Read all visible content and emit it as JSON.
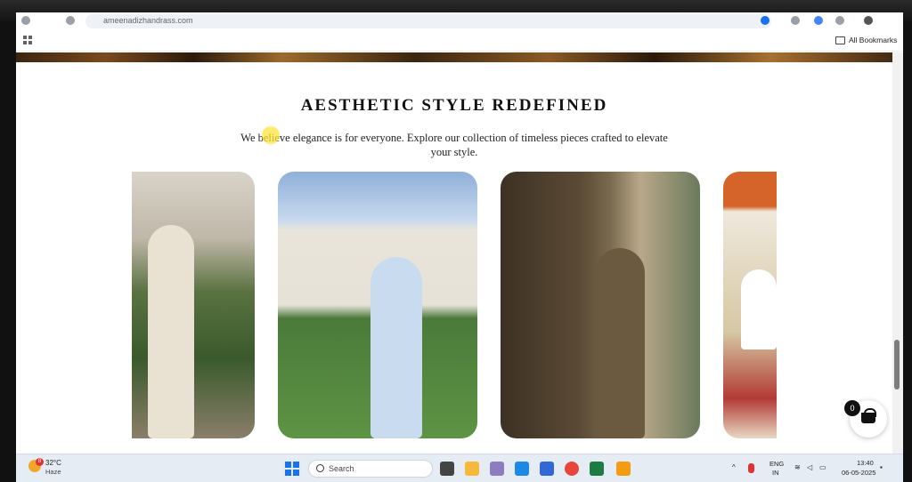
{
  "browser": {
    "url": "ameenadizhandrass.com",
    "bookmarks_label": "All Bookmarks"
  },
  "section": {
    "heading": "AESTHETIC STYLE REDEFINED",
    "subtitle": "We believe elegance is for everyone. Explore our collection of timeless pieces crafted to elevate your style."
  },
  "gallery": {
    "cards": [
      {
        "subject": "woman in cream outfit with brown handbag beside hedge"
      },
      {
        "subject": "man in light blue shirt in front of chateau"
      },
      {
        "subject": "man in vintage study with suspenders"
      },
      {
        "subject": "partially visible model in white shirt"
      }
    ]
  },
  "cart": {
    "count": "0"
  },
  "taskbar": {
    "weather_badge": "8",
    "temperature": "32°C",
    "condition": "Haze",
    "search_placeholder": "Search",
    "lang_line1": "ENG",
    "lang_line2": "IN",
    "time": "13:40",
    "date": "06-05-2025"
  },
  "colors": {
    "accent": "#1a73e8",
    "cart_badge": "#111111"
  }
}
